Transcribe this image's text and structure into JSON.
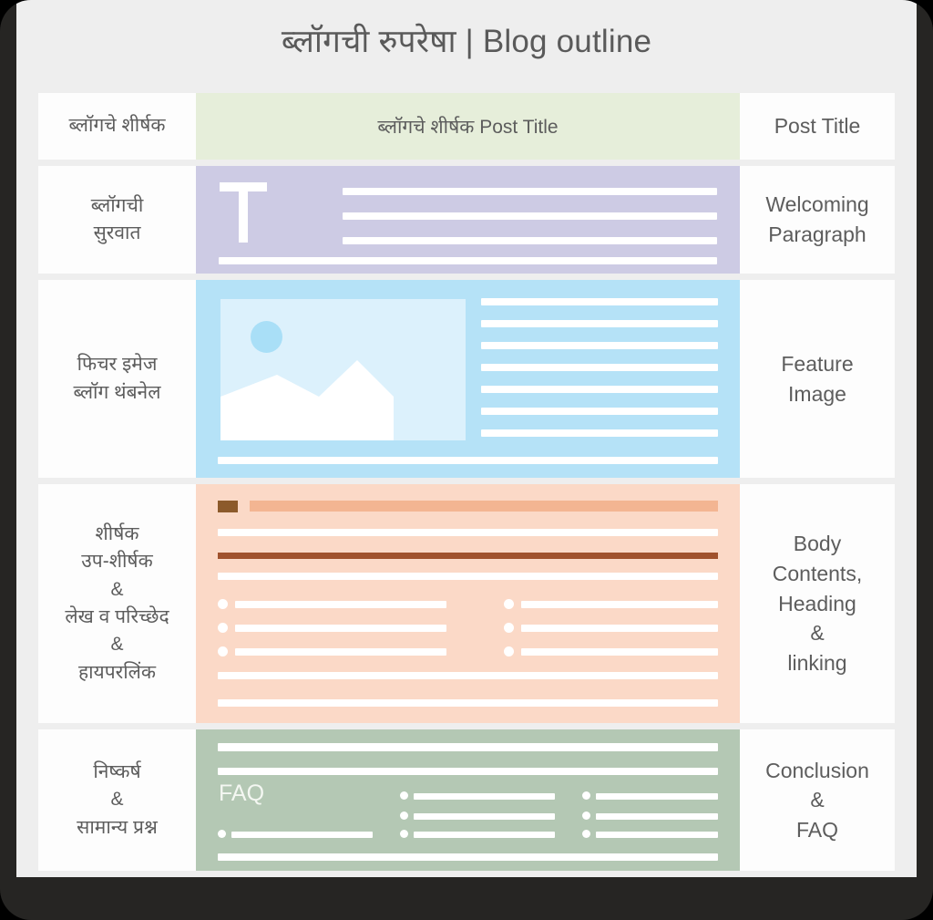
{
  "header": {
    "title": "ब्लॉगची रुपरेषा | Blog outline"
  },
  "colors": {
    "page_background": "#eeeeee",
    "bezel": "#262523",
    "cell_background": "#fdfdfd",
    "text": "#5d5d5d",
    "row_post_title": "#e6eeda",
    "row_welcoming": "#cdcbe4",
    "row_feature_image": "#b5e2f7",
    "row_body_contents": "#fbd9c7",
    "row_conclusion": "#b4c8b4",
    "accent_heading_square": "#8c5a2b",
    "accent_heading_bar": "#f3b592",
    "accent_link_bar": "#a0522d",
    "cursor": "#7c4a21"
  },
  "rows": [
    {
      "id": "post-title",
      "left_label": "ब्लॉगचे शीर्षक",
      "center_label": "ब्लॉगचे शीर्षक Post Title",
      "right_label": "Post Title"
    },
    {
      "id": "welcoming-paragraph",
      "left_label": "ब्लॉगची\nसुरवात",
      "center_label": "",
      "right_label": "Welcoming\nParagraph",
      "icon": "drop-cap-T"
    },
    {
      "id": "feature-image",
      "left_label": "फिचर इमेज\nब्लॉग थंबनेल",
      "center_label": "",
      "right_label": "Feature\nImage",
      "icon": "image-placeholder",
      "text_lines": 7
    },
    {
      "id": "body-contents",
      "left_label": "शीर्षक\nउप-शीर्षक\n&\nलेख व परिच्छेद\n&\nहायपरलिंक",
      "center_label": "",
      "right_label": "Body\nContents,\nHeading\n&\nlinking",
      "icon": "cursor-arrow",
      "bullet_rows": 3
    },
    {
      "id": "conclusion-faq",
      "left_label": "निष्कर्ष\n&\nसामान्य प्रश्न",
      "center_label": "FAQ",
      "right_label": "Conclusion\n&\nFAQ",
      "bullet_columns": 3,
      "bullet_rows": 3
    }
  ]
}
